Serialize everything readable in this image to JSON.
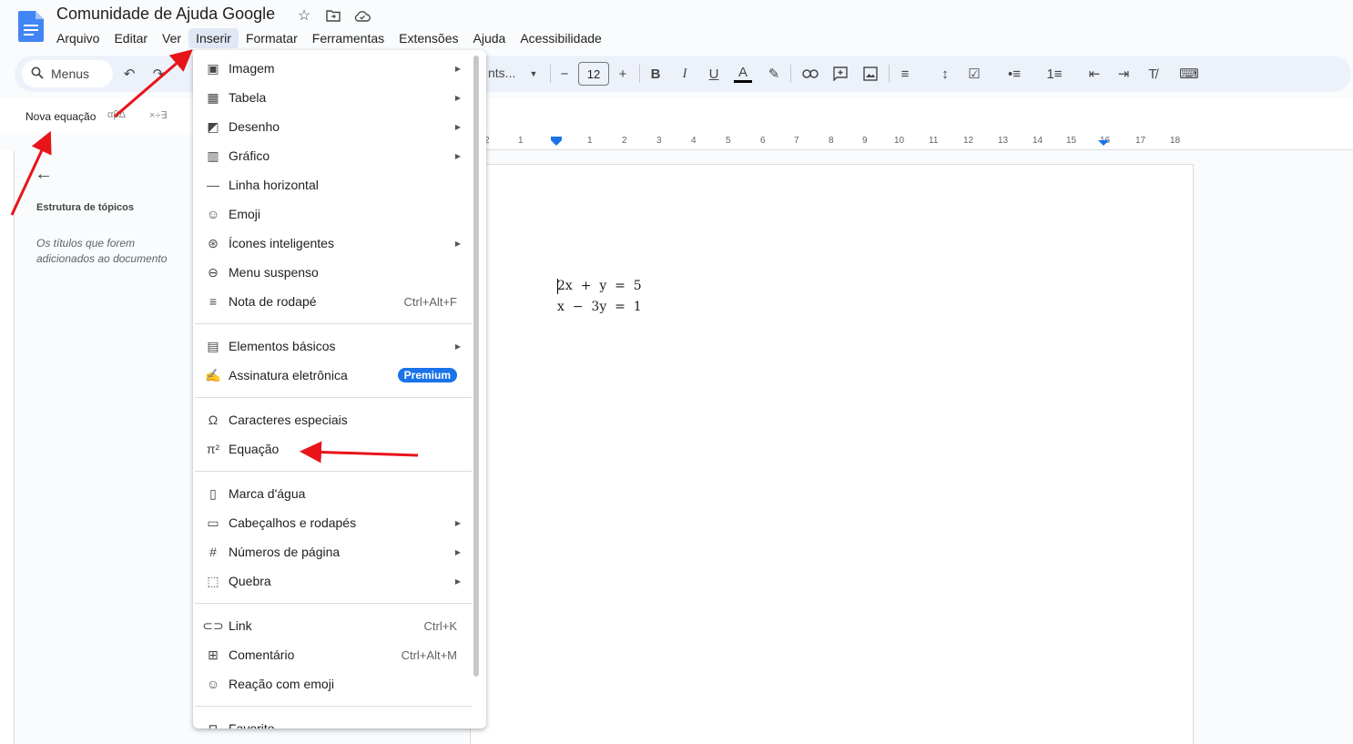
{
  "app": {
    "doc_title": "Comunidade de Ajuda Google",
    "menus": [
      "Arquivo",
      "Editar",
      "Ver",
      "Inserir",
      "Formatar",
      "Ferramentas",
      "Extensões",
      "Ajuda",
      "Acessibilidade"
    ],
    "active_menu": "Inserir"
  },
  "toolbar": {
    "search_label": "Menus",
    "font_name": "nts...",
    "font_size": "12"
  },
  "equation_bar": {
    "label": "Nova equação",
    "greek": "αβΔ",
    "ops": "×÷∃"
  },
  "outline": {
    "title": "Estrutura de tópicos",
    "hint": "Os títulos que forem adicionados ao documento aparecerão aqui."
  },
  "ruler": {
    "numbers": [
      "2",
      "1",
      "1",
      "2",
      "3",
      "4",
      "5",
      "6",
      "7",
      "8",
      "9",
      "10",
      "11",
      "12",
      "13",
      "14",
      "15",
      "16",
      "17",
      "18"
    ]
  },
  "document": {
    "equation_line_1": "2x  +  y  =  5",
    "equation_line_2": "x  −  3y  =  1"
  },
  "insert_menu": {
    "items": [
      {
        "label": "Imagem",
        "icon": "image-icon",
        "submenu": true
      },
      {
        "label": "Tabela",
        "icon": "table-icon",
        "submenu": true
      },
      {
        "label": "Desenho",
        "icon": "drawing-icon",
        "submenu": true
      },
      {
        "label": "Gráfico",
        "icon": "chart-icon",
        "submenu": true
      },
      {
        "label": "Linha horizontal",
        "icon": "horizontal-line-icon"
      },
      {
        "label": "Emoji",
        "icon": "emoji-icon"
      },
      {
        "label": "Ícones inteligentes",
        "icon": "smart-chips-icon",
        "submenu": true
      },
      {
        "label": "Menu suspenso",
        "icon": "dropdown-icon"
      },
      {
        "label": "Nota de rodapé",
        "icon": "footnote-icon",
        "shortcut": "Ctrl+Alt+F"
      },
      {
        "label": "Elementos básicos",
        "icon": "building-blocks-icon",
        "submenu": true
      },
      {
        "label": "Assinatura eletrônica",
        "icon": "signature-icon",
        "badge": "Premium"
      },
      {
        "label": "Caracteres especiais",
        "icon": "omega-icon"
      },
      {
        "label": "Equação",
        "icon": "pi-icon"
      },
      {
        "label": "Marca d'água",
        "icon": "watermark-icon"
      },
      {
        "label": "Cabeçalhos e rodapés",
        "icon": "header-footer-icon",
        "submenu": true
      },
      {
        "label": "Números de página",
        "icon": "hash-icon",
        "submenu": true
      },
      {
        "label": "Quebra",
        "icon": "page-break-icon",
        "submenu": true
      },
      {
        "label": "Link",
        "icon": "link-icon",
        "shortcut": "Ctrl+K"
      },
      {
        "label": "Comentário",
        "icon": "comment-icon",
        "shortcut": "Ctrl+Alt+M"
      },
      {
        "label": "Reação com emoji",
        "icon": "emoji-reaction-icon"
      },
      {
        "label": "Favorito",
        "icon": "bookmark-icon"
      }
    ]
  },
  "colors": {
    "accent": "#1a73e8",
    "annotation_arrow": "#e8141a"
  }
}
